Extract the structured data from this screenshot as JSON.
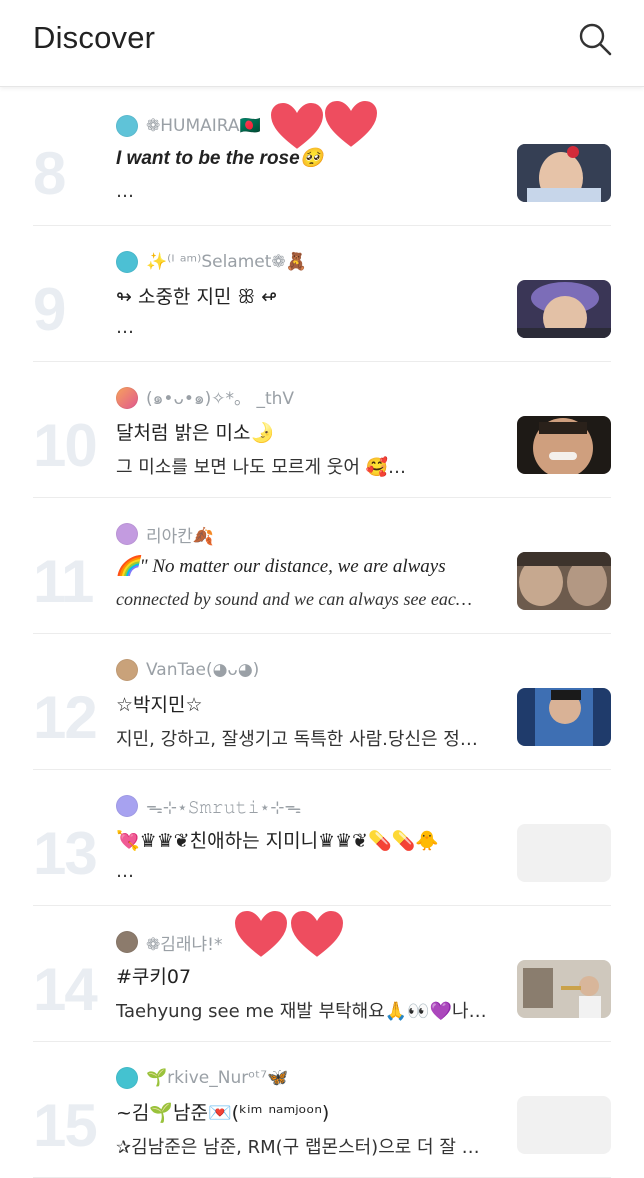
{
  "header": {
    "title": "Discover",
    "search_icon": "search-icon"
  },
  "posts": [
    {
      "rank": "8",
      "author": "❁HUMAIRA🇧🇩",
      "title": "I want to be the rose🥺",
      "excerpt": "…",
      "avatar_color": "#5fc3d8",
      "thumb": "photo"
    },
    {
      "rank": "9",
      "author": "✨⁽ᴵ ᵃᵐ⁾Selamet❁🧸",
      "title": "↬ 소중한 지민 ꕥ ↫",
      "excerpt": "…",
      "avatar_color": "#4cc0d4",
      "thumb": "photo"
    },
    {
      "rank": "10",
      "author": "(๑•ᴗ•๑)✧*。 _thV",
      "title": "달처럼 밝은 미소🌛",
      "excerpt": "  그 미소를 보면 나도 모르게 웃어 🥰…",
      "avatar_color": "#f28c6b",
      "thumb": "photo"
    },
    {
      "rank": "11",
      "author": "리아칸🍂",
      "title": "🌈\" No matter our distance, we are always",
      "excerpt": "connected by sound and we can always see eac…",
      "avatar_color": "#c39be0",
      "thumb": "photo"
    },
    {
      "rank": "12",
      "author": "VanTae(◕ᴗ◕)",
      "title": "☆박지민☆",
      "excerpt": "지민, 강하고, 잘생기고 독특한 사람.당신은 정…",
      "avatar_color": "#c9a27a",
      "thumb": "photo"
    },
    {
      "rank": "13",
      "author": "ᯓ⊹⋆𝚂𝚖𝚛𝚞𝚝𝚒⋆⊹ᯓ",
      "title": "💘♛♛❦친애하는 지미니♛♛❦💊💊🐥",
      "excerpt": "…",
      "avatar_color": "#a7a2f0",
      "thumb": "empty"
    },
    {
      "rank": "14",
      "author": "❁김래냐!*",
      "title": "#쿠키07",
      "excerpt": "Taehyung see me 재발 부탁해요🙏👀💜나…",
      "avatar_color": "#8c7b6c",
      "thumb": "photo"
    },
    {
      "rank": "15",
      "author": "🌱rkive_Nurᵒᵗ⁷🦋",
      "title": "~김🌱남준💌(ᵏⁱᵐ ⁿᵃᵐʲᵒᵒⁿ)",
      "excerpt": "✰김남준은 남준, RM(구 랩몬스터)으로 더 잘 …",
      "avatar_color": "#44c2d0",
      "thumb": "empty"
    }
  ],
  "colors": {
    "rank": "#e9edf2",
    "author": "#9aa0a6",
    "heart": "#ee4d5f"
  }
}
